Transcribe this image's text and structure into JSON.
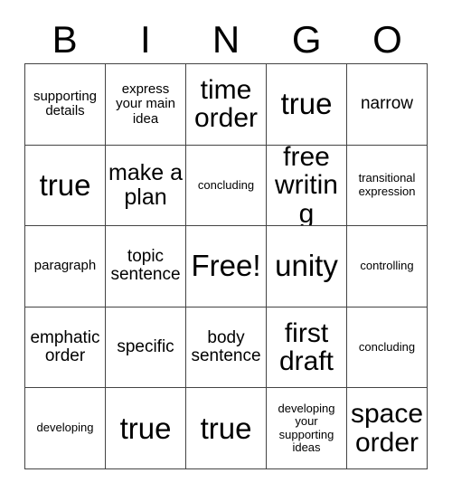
{
  "card": {
    "header_letters": [
      "B",
      "I",
      "N",
      "G",
      "O"
    ],
    "free_space_label": "Free!",
    "colors": {
      "border": "#444444",
      "text": "#000000",
      "background": "#ffffff"
    },
    "rows": [
      [
        {
          "text": "supporting details",
          "size": "sm"
        },
        {
          "text": "express your main idea",
          "size": "sm"
        },
        {
          "text": "time order",
          "size": "xl"
        },
        {
          "text": "true",
          "size": "xxl"
        },
        {
          "text": "narrow",
          "size": "md"
        }
      ],
      [
        {
          "text": "true",
          "size": "xxl"
        },
        {
          "text": "make a plan",
          "size": "lg"
        },
        {
          "text": "concluding",
          "size": "xs"
        },
        {
          "text": "free writing",
          "size": "xl"
        },
        {
          "text": "transitional expression",
          "size": "xs"
        }
      ],
      [
        {
          "text": "paragraph",
          "size": "sm"
        },
        {
          "text": "topic sentence",
          "size": "md"
        },
        {
          "text": "Free!",
          "size": "xxl"
        },
        {
          "text": "unity",
          "size": "xxl"
        },
        {
          "text": "controlling",
          "size": "xs"
        }
      ],
      [
        {
          "text": "emphatic order",
          "size": "md"
        },
        {
          "text": "specific",
          "size": "md"
        },
        {
          "text": "body sentence",
          "size": "md"
        },
        {
          "text": "first draft",
          "size": "xl"
        },
        {
          "text": "concluding",
          "size": "xs"
        }
      ],
      [
        {
          "text": "developing",
          "size": "xs"
        },
        {
          "text": "true",
          "size": "xxl"
        },
        {
          "text": "true",
          "size": "xxl"
        },
        {
          "text": "developing your supporting ideas",
          "size": "xs"
        },
        {
          "text": "space order",
          "size": "xl"
        }
      ]
    ]
  }
}
